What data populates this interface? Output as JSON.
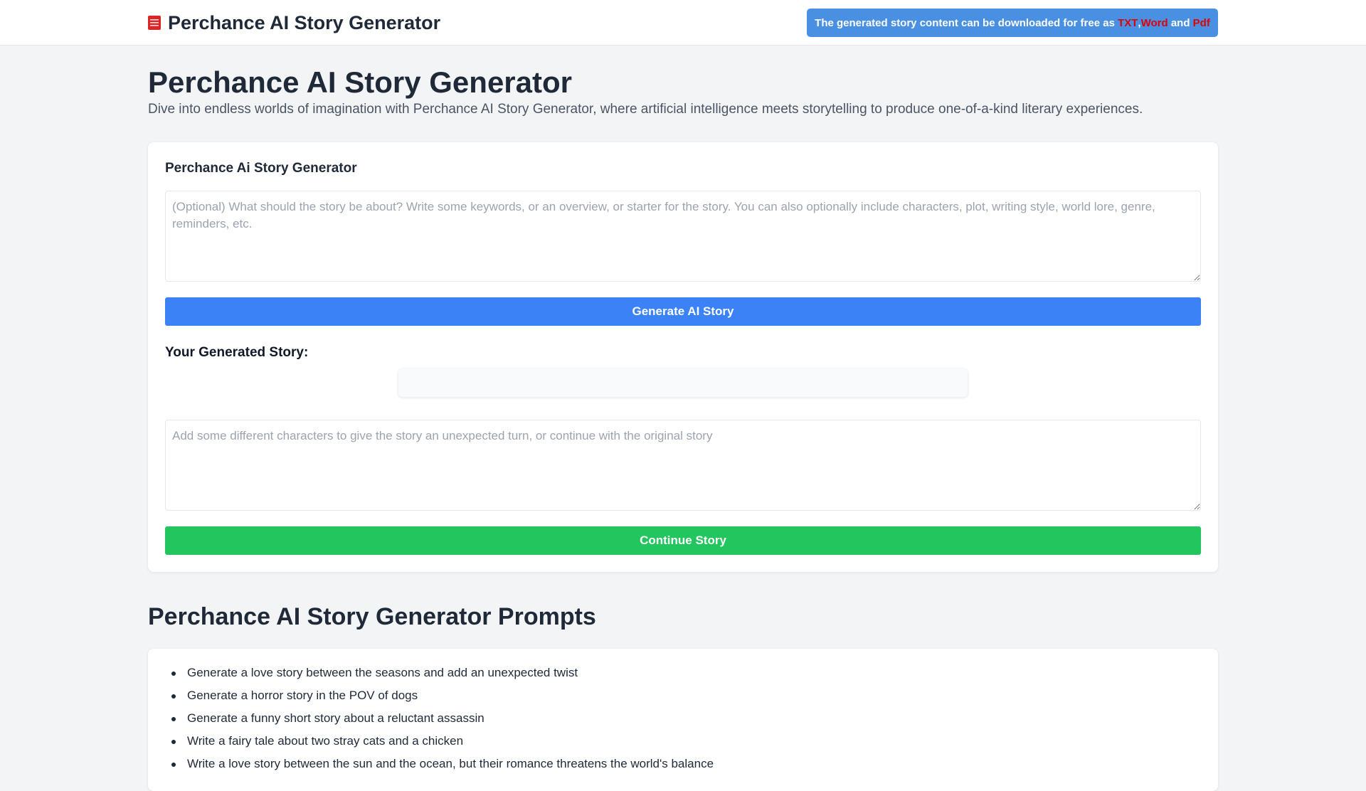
{
  "header": {
    "brand_title": "Perchance AI Story Generator",
    "brand_icon": "book-icon",
    "notice": {
      "prefix": "The generated story content can be downloaded for free as ",
      "txt": "TXT",
      "separator": ",",
      "word": "Word",
      "and": " and ",
      "pdf": "Pdf"
    }
  },
  "main": {
    "title": "Perchance AI Story Generator",
    "description": "Dive into endless worlds of imagination with Perchance AI Story Generator, where artificial intelligence meets storytelling to produce one-of-a-kind literary experiences."
  },
  "generator": {
    "title": "Perchance Ai Story Generator",
    "prompt_placeholder": "(Optional) What should the story be about? Write some keywords, or an overview, or starter for the story. You can also optionally include characters, plot, writing style, world lore, genre, reminders, etc.",
    "prompt_value": "",
    "generate_button": "Generate AI Story",
    "story_label": "Your Generated Story:",
    "continue_placeholder": "Add some different characters to give the story an unexpected turn, or continue with the original story",
    "continue_value": "",
    "continue_button": "Continue Story"
  },
  "prompts": {
    "title": "Perchance AI Story Generator Prompts",
    "items": [
      "Generate a love story between the seasons and add an unexpected twist",
      "Generate a horror story in the POV of dogs",
      "Generate a funny short story about a reluctant assassin",
      "Write a fairy tale about two stray cats and a chicken",
      "Write a love story between the sun and the ocean, but their romance threatens the world's balance"
    ]
  },
  "colors": {
    "page_background": "#f3f4f6",
    "notice_background": "#4a90e2",
    "notice_highlight": "#e00000",
    "generate_button": "#3b82f6",
    "continue_button": "#22c55e",
    "brand_icon": "#dc2626"
  }
}
